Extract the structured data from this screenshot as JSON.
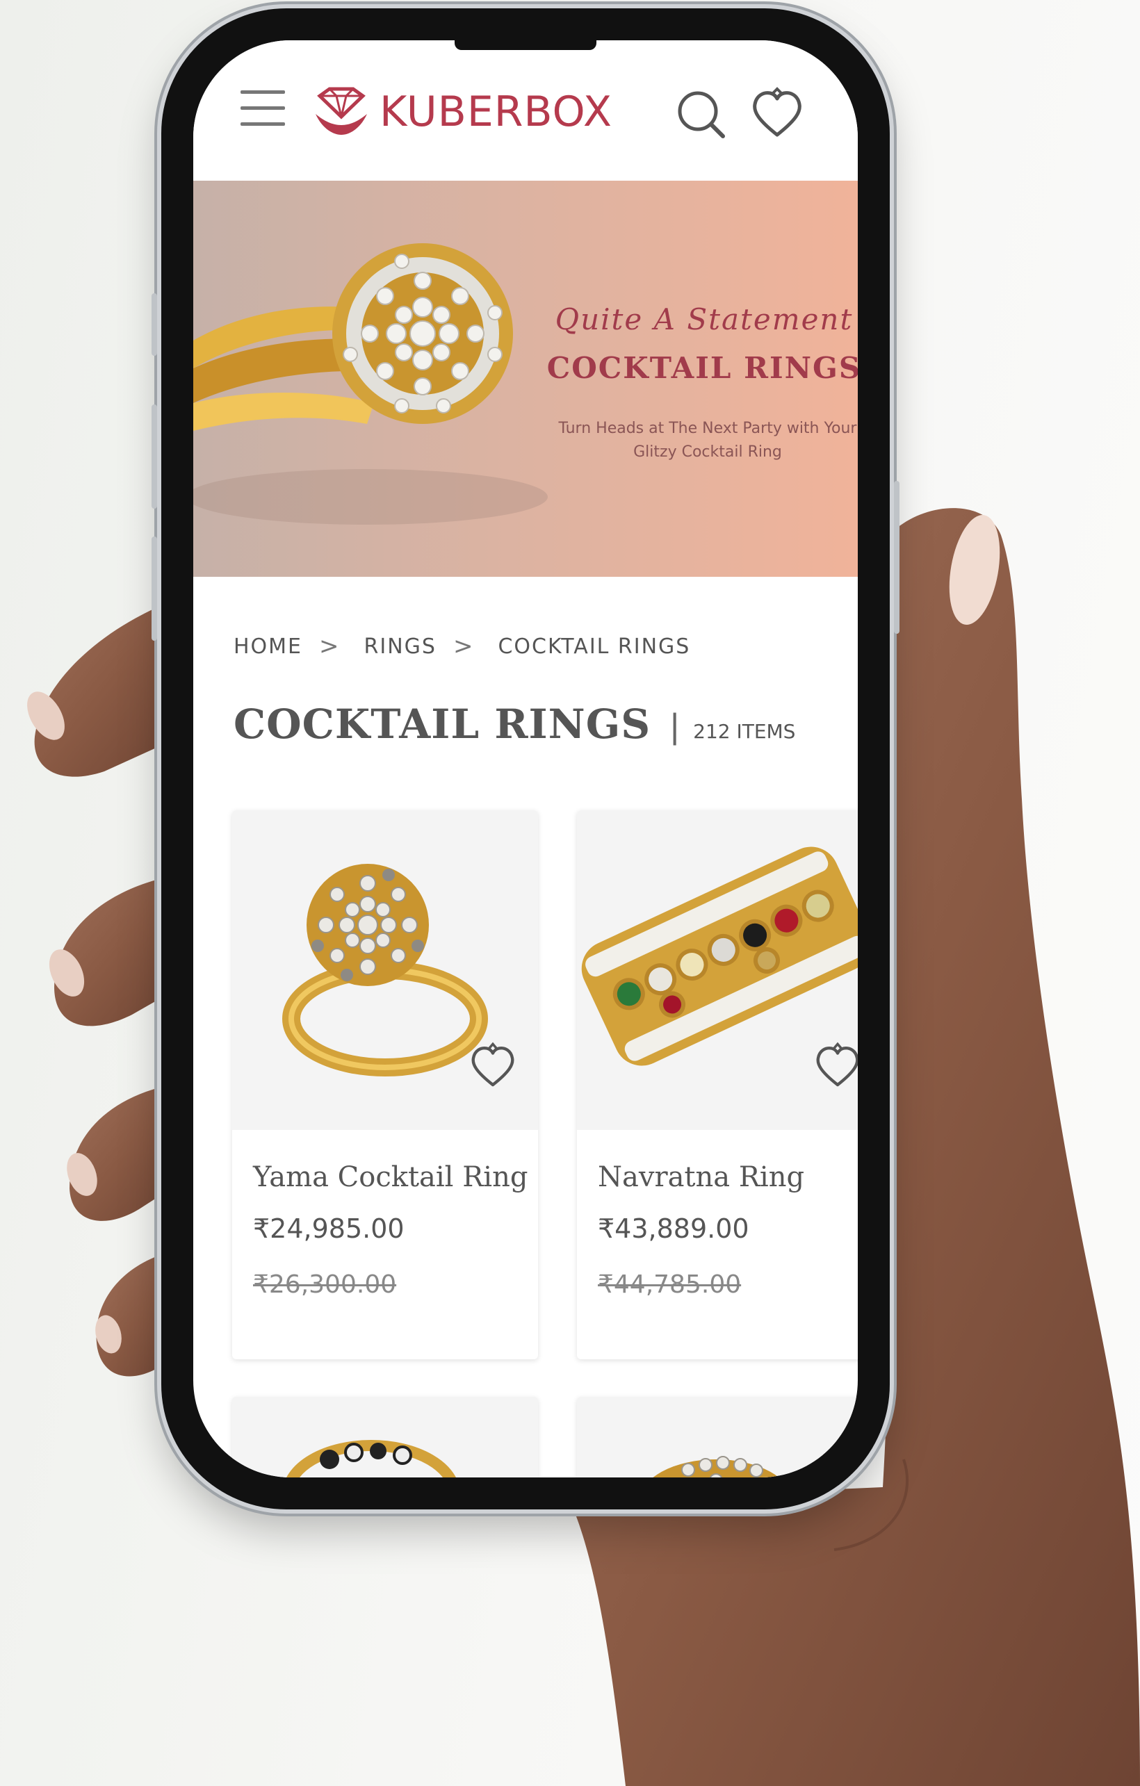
{
  "header": {
    "brand": "KUBERBOX"
  },
  "banner": {
    "script_text": "Quite A Statement",
    "title": "COCKTAIL RINGS",
    "subtitle_line1": "Turn Heads at The Next Party with Your",
    "subtitle_line2": "Glitzy Cocktail Ring"
  },
  "breadcrumb": {
    "items": [
      "HOME",
      "RINGS",
      "COCKTAIL RINGS"
    ],
    "separator": ">"
  },
  "page": {
    "title": "COCKTAIL RINGS",
    "divider": "|",
    "count": "212 ITEMS"
  },
  "products": [
    {
      "name": "Yama Cocktail Ring",
      "price": "₹24,985.00",
      "old_price": "₹26,300.00"
    },
    {
      "name": "Navratna Ring",
      "price": "₹43,889.00",
      "old_price": "₹44,785.00"
    }
  ],
  "colors": {
    "brand": "#b53a4d",
    "banner_text": "#a13b4b",
    "gold": "#d8a93a"
  }
}
